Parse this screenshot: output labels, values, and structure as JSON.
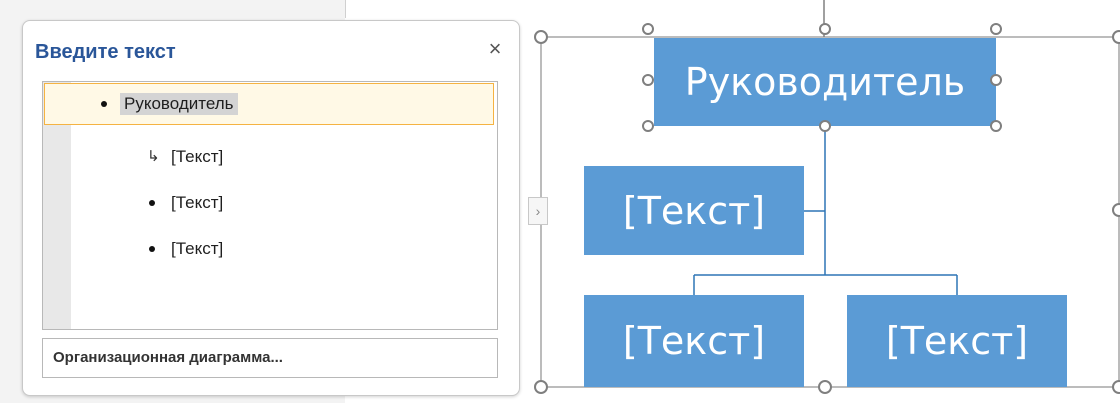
{
  "text_pane": {
    "title": "Введите текст",
    "close_symbol": "×",
    "items": [
      {
        "label": "Руководитель",
        "level": 0,
        "bullet": "dot",
        "selected": true
      },
      {
        "label": "[Текст]",
        "level": 1,
        "bullet": "return-arrow"
      },
      {
        "label": "[Текст]",
        "level": 1,
        "bullet": "dot"
      },
      {
        "label": "[Текст]",
        "level": 1,
        "bullet": "dot"
      }
    ],
    "footer_link": "Организационная диаграмма..."
  },
  "toggle_symbol": "›",
  "org_chart": {
    "top": "Руководитель",
    "assistant": "[Текст]",
    "subordinates": [
      "[Текст]",
      "[Текст]"
    ]
  },
  "colors": {
    "box_fill": "#5b9bd5",
    "connector": "#2e75b6",
    "title_blue": "#2a5699",
    "selection_border": "#f5b342"
  }
}
